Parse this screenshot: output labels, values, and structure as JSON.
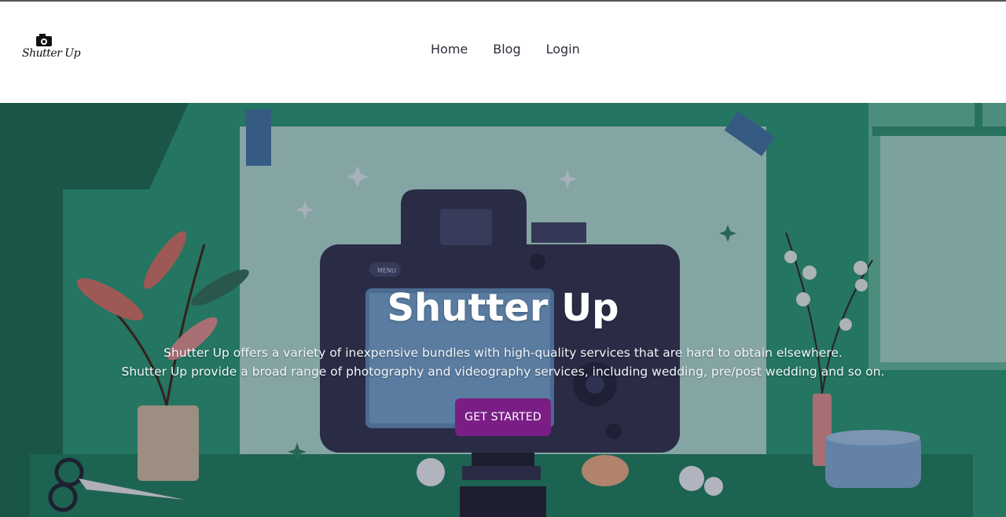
{
  "brand": {
    "logo_text": "Shutter Up"
  },
  "nav": {
    "items": [
      {
        "label": "Home"
      },
      {
        "label": "Blog"
      },
      {
        "label": "Login"
      }
    ]
  },
  "hero": {
    "title": "Shutter Up",
    "description": [
      "Shutter Up offers a variety of inexpensive bundles with high-quality services that are hard to obtain elsewhere.",
      "Shutter Up provide a broad range of photography and videography services, including wedding, pre/post wedding and so on."
    ],
    "cta_label": "GET STARTED",
    "camera_menu_label": "MENU"
  },
  "colors": {
    "cta": "#7a1e86",
    "hero_green": "#1f8a6a",
    "nav_text": "#2b2f3a"
  }
}
